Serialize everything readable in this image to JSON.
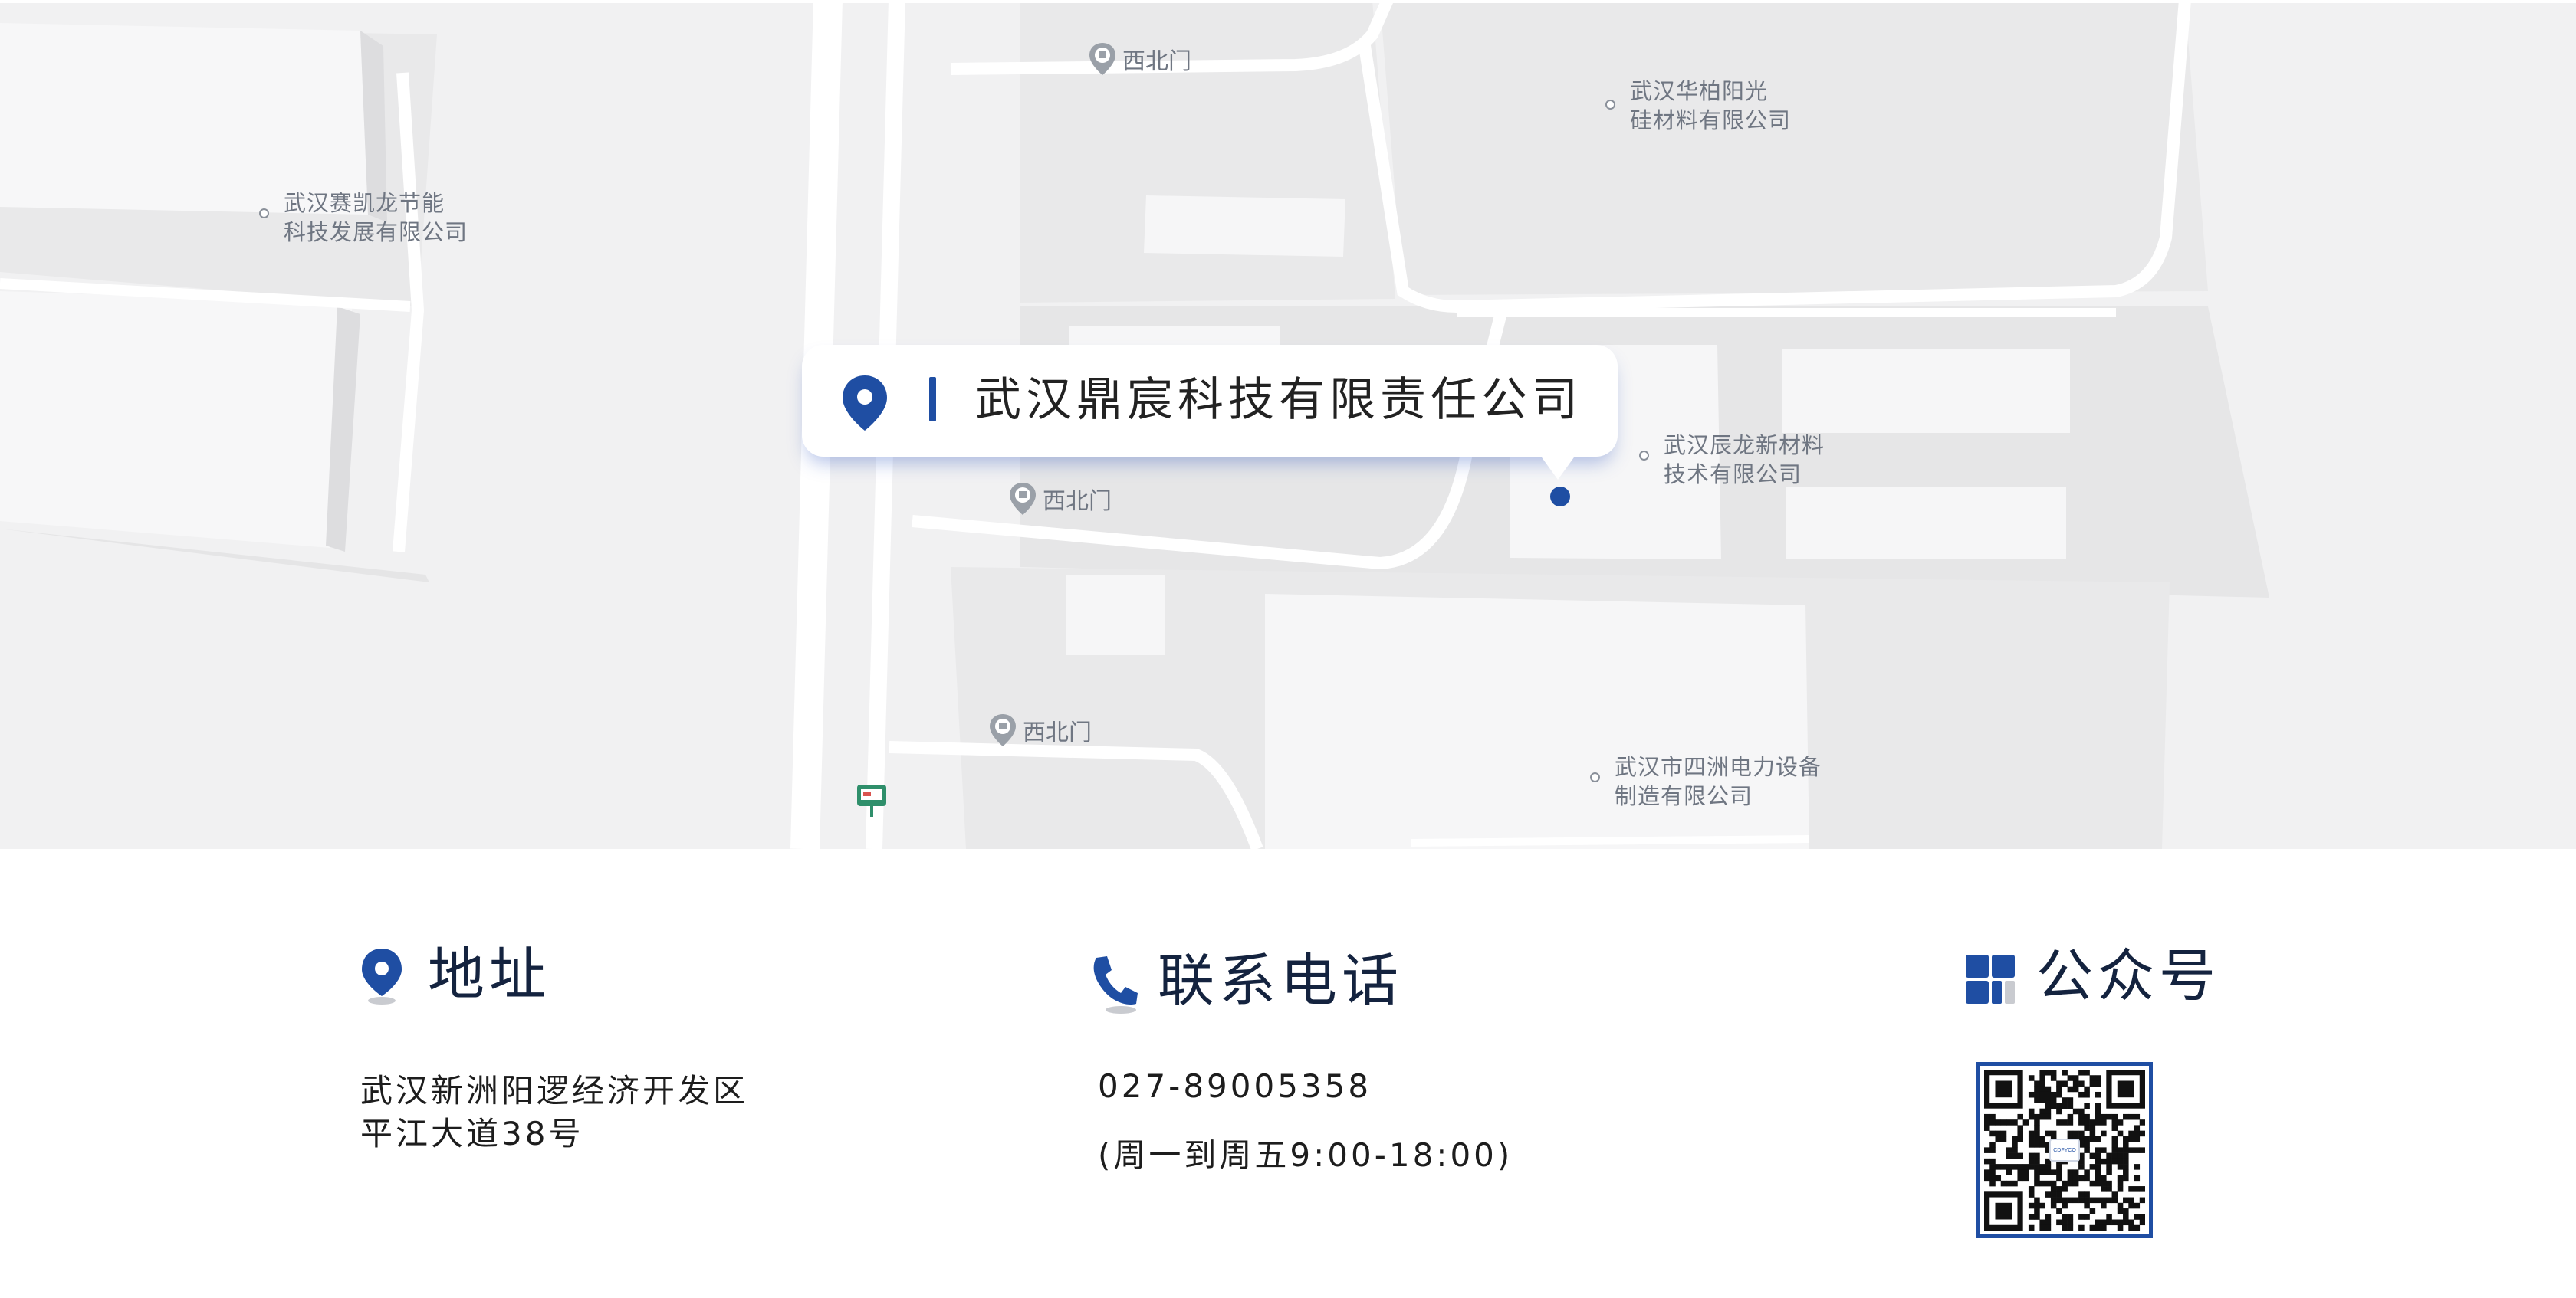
{
  "company_label": "武汉鼎宸科技有限责任公司",
  "map": {
    "gate_label": "西北门",
    "pois": [
      {
        "line1": "武汉华柏阳光",
        "line2": "硅材料有限公司"
      },
      {
        "line1": "武汉赛凯龙节能",
        "line2": "科技发展有限公司"
      },
      {
        "line1": "武汉辰龙新材料",
        "line2": "技术有限公司"
      },
      {
        "line1": "武汉市四洲电力设备",
        "line2": "制造有限公司"
      }
    ]
  },
  "info": {
    "address": {
      "title": "地址",
      "line1": "武汉新洲阳逻经济开发区",
      "line2": "平江大道38号"
    },
    "phone": {
      "title": "联系电话",
      "number": "027-89005358",
      "hours": "(周一到周五9:00-18:00)"
    },
    "wechat": {
      "title": "公众号",
      "qr_center_text": "CDFYCO"
    }
  },
  "colors": {
    "accent": "#1f4ea3",
    "map_bg": "#f1f1f2",
    "road": "#ffffff",
    "block": "#e8e8e9"
  },
  "icons": [
    "location-pin-icon",
    "phone-icon",
    "grid-icon",
    "qr-code",
    "gate-marker-icon",
    "bus-stop-icon"
  ]
}
